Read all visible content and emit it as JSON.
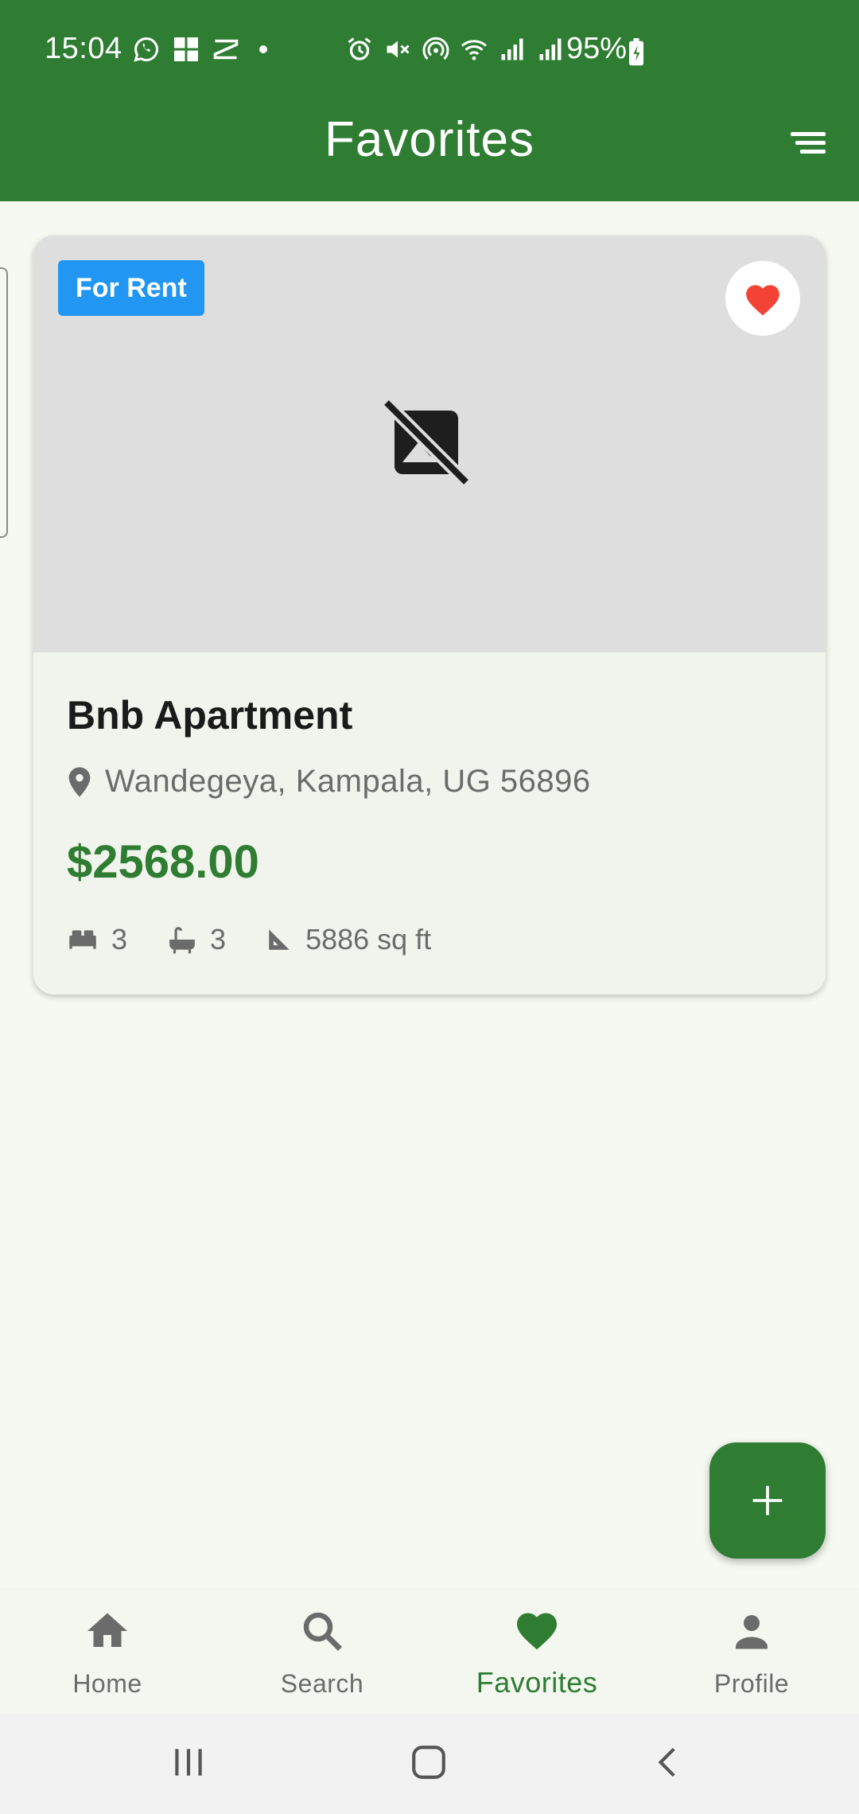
{
  "status_bar": {
    "time": "15:04",
    "battery": "95%",
    "left_icons": [
      "whatsapp-icon",
      "app-grid-icon",
      "capcut-icon"
    ],
    "right_icons": [
      "alarm-icon",
      "mute-icon",
      "hotspot-icon",
      "wifi-icon",
      "signal-icon",
      "signal-icon",
      "battery-charging-icon"
    ]
  },
  "app_bar": {
    "title": "Favorites",
    "menu_icon": "sort-menu-icon",
    "color": "#2e7d32"
  },
  "property": {
    "badge": "For Rent",
    "badge_color": "#2196f3",
    "favorite_icon": "heart-icon",
    "image_placeholder_icon": "no-image-icon",
    "title": "Bnb Apartment",
    "location": "Wandegeya, Kampala, UG 56896",
    "price": "$2568.00",
    "price_color": "#2e7d32",
    "beds": "3",
    "baths": "3",
    "area": "5886 sq ft"
  },
  "fab": {
    "icon": "plus-icon"
  },
  "bottom_nav": {
    "items": [
      {
        "label": "Home",
        "icon": "home-icon",
        "active": false
      },
      {
        "label": "Search",
        "icon": "search-icon",
        "active": false
      },
      {
        "label": "Favorites",
        "icon": "heart-icon",
        "active": true
      },
      {
        "label": "Profile",
        "icon": "person-icon",
        "active": false
      }
    ]
  },
  "system_nav": [
    "recents-icon",
    "home-circle-icon",
    "back-icon"
  ]
}
